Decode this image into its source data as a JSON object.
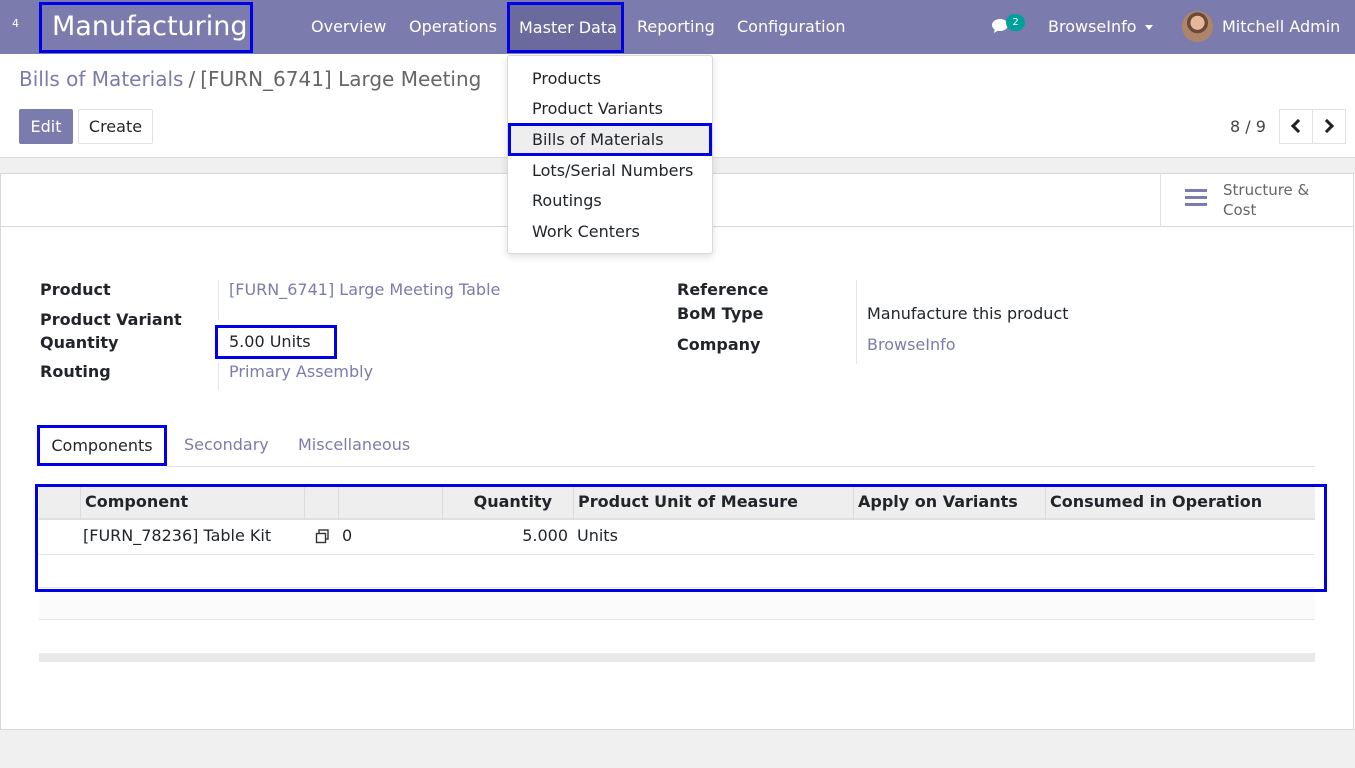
{
  "navbar": {
    "apps_badge": "4",
    "brand": "Manufacturing",
    "menus": [
      "Overview",
      "Operations",
      "Master Data",
      "Reporting",
      "Configuration"
    ],
    "chat_count": "2",
    "company": "BrowseInfo",
    "user": "Mitchell Admin"
  },
  "master_data_menu": [
    "Products",
    "Product Variants",
    "Bills of Materials",
    "Lots/Serial Numbers",
    "Routings",
    "Work Centers"
  ],
  "breadcrumb": {
    "parent": "Bills of Materials",
    "separator": "/",
    "current": "[FURN_6741] Large Meeting"
  },
  "buttons": {
    "edit": "Edit",
    "create": "Create"
  },
  "pager": "8 / 9",
  "stat_button": {
    "line1": "Structure &",
    "line2": "Cost"
  },
  "form": {
    "product_label": "Product",
    "product_value": "[FURN_6741] Large Meeting Table",
    "variant_label": "Product Variant",
    "quantity_label": "Quantity",
    "quantity_value": "5.00",
    "quantity_uom": "Units",
    "routing_label": "Routing",
    "routing_value": "Primary Assembly",
    "reference_label": "Reference",
    "bom_type_label": "BoM Type",
    "bom_type_value": "Manufacture this product",
    "company_label": "Company",
    "company_value": "BrowseInfo"
  },
  "tabs": [
    "Components",
    "Secondary",
    "Miscellaneous"
  ],
  "table": {
    "headers": [
      "Component",
      "Quantity",
      "Product Unit of Measure",
      "Apply on Variants",
      "Consumed in Operation"
    ],
    "rows": [
      {
        "component": "[FURN_78236] Table Kit",
        "count": "0",
        "quantity": "5.000",
        "uom": "Units"
      }
    ]
  }
}
